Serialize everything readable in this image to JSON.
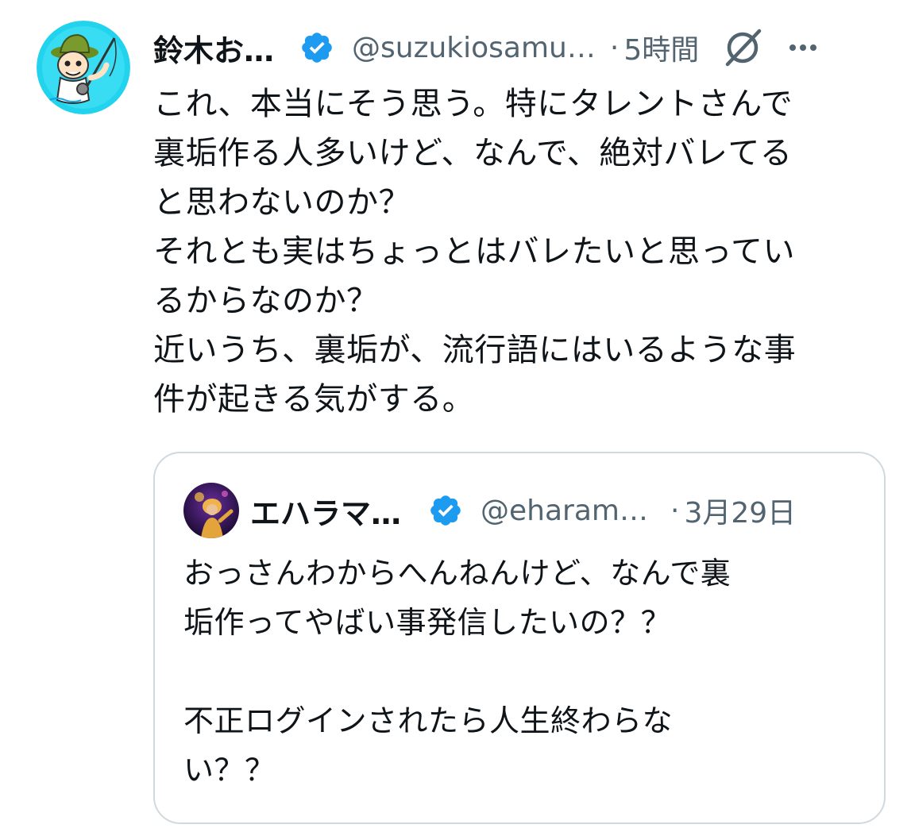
{
  "tweet": {
    "author": {
      "display_name": "鈴木お…",
      "handle": "@suzukiosamu…",
      "avatar_icon": "fishing-cartoon-avatar"
    },
    "separator": "·",
    "time": "5時間",
    "text": "これ、本当にそう思う。特にタレントさんで\n裏垢作る人多いけど、なんで、絶対バレてる\nと思わないのか？\nそれとも実はちょっとはバレたいと思ってい\nるからなのか？\n近いうち、裏垢が、流行語にはいるような事\n件が起きる気がする。",
    "verified_icon": "verified-badge-icon",
    "grok_icon": "grok-icon",
    "more_icon": "more-options-icon"
  },
  "quoted": {
    "author": {
      "display_name": "エハラマ…",
      "handle": "@eharam…",
      "avatar_icon": "stage-performer-avatar"
    },
    "separator": "·",
    "time": "3月29日",
    "text": "おっさんわからへんねんけど、なんで裏\n垢作ってやばい事発信したいの？？\n\n不正ログインされたら人生終わらな\nい？？"
  },
  "colors": {
    "verified_blue": "#1d9bf0",
    "secondary_text": "#536471",
    "primary_text": "#0f1419",
    "card_border": "#cfd9de"
  }
}
